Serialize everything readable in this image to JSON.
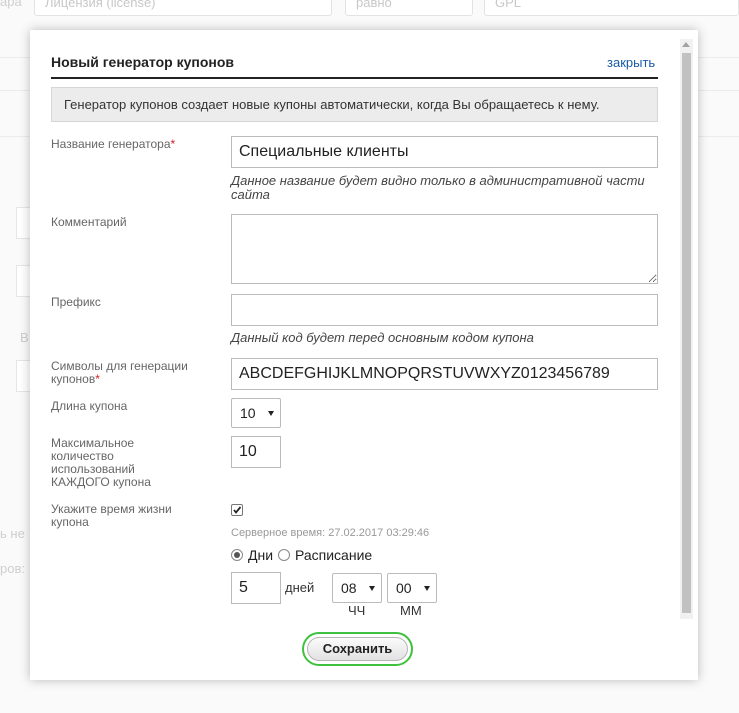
{
  "background": {
    "field_left_text": "ара",
    "field_1_text": "Лицензия (license)",
    "field_2_text": "равно",
    "field_3_text": "GPL",
    "side_text_1": "В",
    "side_text_2": "ь не",
    "side_text_3": "ров:"
  },
  "dialog": {
    "title": "Новый генератор купонов",
    "close_label": "закрыть",
    "info_text": "Генератор купонов создает новые купоны автоматически, когда Вы обращаетесь к нему."
  },
  "form": {
    "name_label": "Название генератора",
    "required_mark": "*",
    "name_value": "Специальные клиенты",
    "name_hint": "Данное название будет видно только в административной части сайта",
    "comment_label": "Комментарий",
    "comment_value": "",
    "prefix_label": "Префикс",
    "prefix_value": "",
    "prefix_hint": "Данный код будет перед основным кодом купона",
    "chars_label_line1": "Символы для генерации",
    "chars_label_line2": "купонов",
    "chars_value": "ABCDEFGHIJKLMNOPQRSTUVWXYZ0123456789",
    "length_label": "Длина купона",
    "length_value": "10",
    "max_uses_label": "Максимальное количество использований КАЖДОГО купона",
    "max_uses_value": "10",
    "lifetime_label": "Укажите время жизни купона",
    "lifetime_checked": true,
    "server_time": "Серверное время: 27.02.2017 03:29:46",
    "radio_days_label": "Дни",
    "radio_schedule_label": "Расписание",
    "selected_mode": "days",
    "days_value": "5",
    "days_unit": "дней",
    "hours_value": "08",
    "hours_label": "ЧЧ",
    "minutes_value": "00",
    "minutes_label": "ММ",
    "save_label": "Сохранить"
  }
}
